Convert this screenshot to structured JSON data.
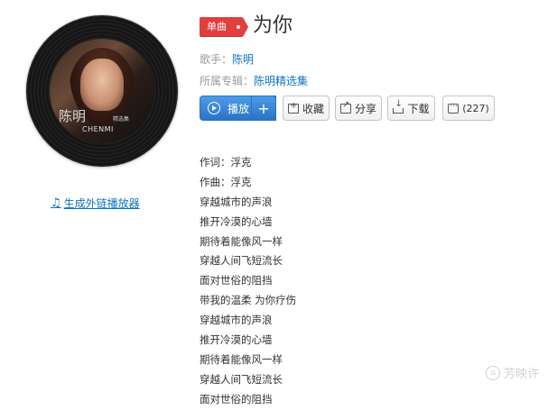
{
  "song": {
    "badge": "单曲",
    "title": "为你",
    "artist_label": "歌手：",
    "artist": "陈明",
    "album_label": "所属专辑：",
    "album": "陈明精选集"
  },
  "cover": {
    "text_big": "陈明",
    "text_small": "CHENMI",
    "text_tiny": "精选集"
  },
  "external_link": "生成外链播放器",
  "buttons": {
    "play": "播放",
    "add": "+",
    "favorite": "收藏",
    "share": "分享",
    "download": "下载",
    "comments": "(227)"
  },
  "lyrics": [
    "作词：浮克",
    "作曲：浮克",
    "穿越城市的声浪",
    "推开冷漠的心墙",
    "期待着能像风一样",
    "穿越人间飞短流长",
    "面对世俗的阻挡",
    "带我的温柔 为你疗伤",
    "穿越城市的声浪",
    "推开冷漠的心墙",
    "期待着能像风一样",
    "穿越人间飞短流长",
    "面对世俗的阻挡"
  ],
  "watermark": "芳映许",
  "colors": {
    "accent_blue": "#0c73c2",
    "badge_red": "#e13e3e",
    "play_blue": "#2a73c6"
  },
  "icons": [
    "music-note-icon",
    "play-circle-icon",
    "add-icon",
    "favorite-icon",
    "share-icon",
    "download-icon",
    "comment-icon"
  ]
}
